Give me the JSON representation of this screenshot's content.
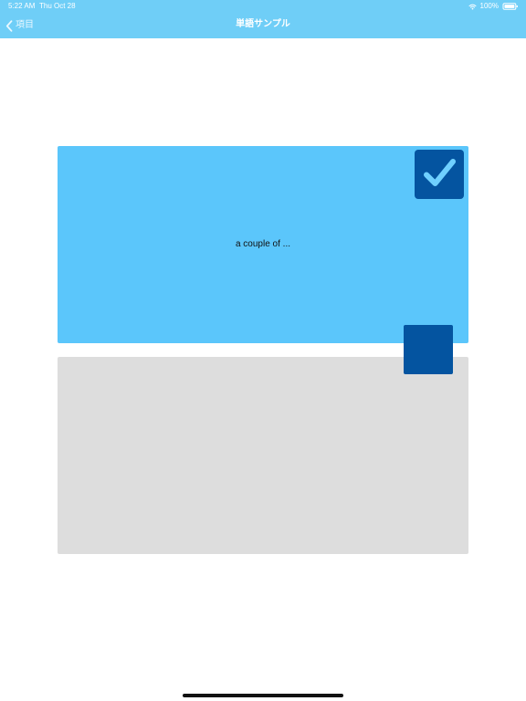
{
  "status_bar": {
    "time": "5:22 AM",
    "date": "Thu Oct 28",
    "battery": "100%"
  },
  "nav": {
    "back_label": "項目",
    "title": "単語サンプル"
  },
  "card": {
    "front_text": "a couple of ...",
    "back_text": ""
  },
  "icons": {
    "back": "chevron-left-icon",
    "wifi": "wifi-icon",
    "battery": "battery-icon",
    "check": "checkmark-icon"
  },
  "colors": {
    "nav_bar": "#6fcef7",
    "front_card": "#5bc6fb",
    "back_card": "#dddddd",
    "button": "#0454a0",
    "checkmark": "#6fd0ff"
  }
}
